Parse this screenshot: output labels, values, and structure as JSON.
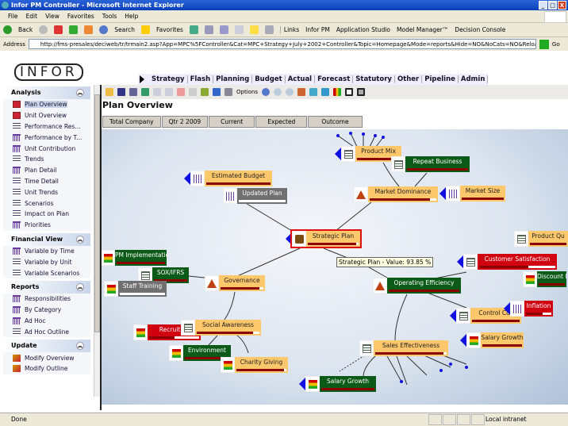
{
  "window": {
    "title": "Infor PM Controller - Microsoft Internet Explorer",
    "controls": [
      "_",
      "□",
      "X"
    ]
  },
  "menu": [
    "File",
    "Edit",
    "View",
    "Favorites",
    "Tools",
    "Help"
  ],
  "ie_toolbar": {
    "back": "Back",
    "search": "Search",
    "favorites": "Favorites",
    "links": "Links",
    "link_items": [
      "Infor PM",
      "Application Studio",
      "Model Manager™",
      "Decision Console"
    ]
  },
  "address": {
    "label": "Address",
    "url": "http://fms-presales/deciweb/tr/trmain2.asp?App=MPC%5FController&Cat=MPC+Strategy+July+2002+Controller&Topic=Homepage&Mode=reports&Hide=NO&NoCats=NO&Reloac",
    "go": "Go"
  },
  "logo": "INFOR",
  "tabs": [
    "Strategy",
    "Flash",
    "Planning",
    "Budget",
    "Actual",
    "Forecast",
    "Statutory",
    "Other",
    "Pipeline",
    "Admin"
  ],
  "active_tab": "Strategy",
  "sidebar": {
    "sections": [
      {
        "title": "Analysis",
        "items": [
          {
            "label": "Plan Overview",
            "icon": "tree"
          },
          {
            "label": "Unit Overview",
            "icon": "tree"
          },
          {
            "label": "Performance Res...",
            "icon": "list"
          },
          {
            "label": "Performance by T...",
            "icon": "grid"
          },
          {
            "label": "Unit Contribution",
            "icon": "grid"
          },
          {
            "label": "Trends",
            "icon": "list"
          },
          {
            "label": "Plan Detail",
            "icon": "grid"
          },
          {
            "label": "Time Detail",
            "icon": "list"
          },
          {
            "label": "Unit Trends",
            "icon": "list"
          },
          {
            "label": "Scenarios",
            "icon": "list"
          },
          {
            "label": "Impact on Plan",
            "icon": "list"
          },
          {
            "label": "Priorities",
            "icon": "grid"
          }
        ]
      },
      {
        "title": "Financial View",
        "items": [
          {
            "label": "Variable by Time",
            "icon": "grid"
          },
          {
            "label": "Variable by Unit",
            "icon": "list"
          },
          {
            "label": "Variable Scenarios",
            "icon": "list"
          }
        ]
      },
      {
        "title": "Reports",
        "items": [
          {
            "label": "Responsibilities",
            "icon": "grid"
          },
          {
            "label": "By Category",
            "icon": "grid"
          },
          {
            "label": "Ad Hoc",
            "icon": "grid"
          },
          {
            "label": "Ad Hoc Outline",
            "icon": "list"
          }
        ]
      },
      {
        "title": "Update",
        "items": [
          {
            "label": "Modify Overview",
            "icon": "mod"
          },
          {
            "label": "Modify Outline",
            "icon": "mod"
          }
        ]
      }
    ]
  },
  "content_toolbar": {
    "options": "Options"
  },
  "page_title": "Plan Overview",
  "filters": [
    "Total Company",
    "Qtr 2 2009",
    "Current",
    "Expected",
    "Outcome"
  ],
  "diagram": {
    "tooltip": "Strategic Plan - Value: 93.85 %",
    "nodes": {
      "estimated_budget": "Estimated Budget",
      "updated_plan": "Updated Plan",
      "strategic_plan": "Strategic Plan",
      "product_mix": "Product Mix",
      "repeat_business": "Repeat Business",
      "market_dominance": "Market Dominance",
      "market_size": "Market Size",
      "operating_efficiency": "Operating Efficiency",
      "product_quality": "Product Qu",
      "customer_satisfaction": "Customer Satisfaction",
      "discount": "Discount I",
      "inflation": "Inflation",
      "control_costs": "Control Cos",
      "salary_growth_right": "Salary Growth",
      "sales_effectiveness": "Sales Effectiveness",
      "salary_growth_bottom": "Salary Growth",
      "pm_implementation": "PM Implementation",
      "sox_ifrs": "SOX/IFRS",
      "staff_training": "Staff Training",
      "governance": "Governance",
      "recruit": "Recruit Lo",
      "social_awareness": "Social Awareness",
      "environment": "Environment",
      "charity_giving": "Charity Giving"
    }
  },
  "status": {
    "text": "Done",
    "zone": "Local intranet"
  }
}
